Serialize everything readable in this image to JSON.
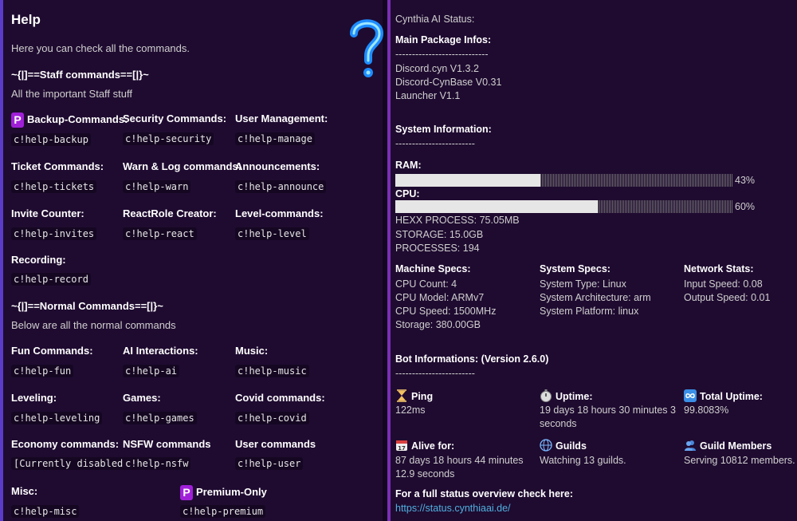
{
  "help": {
    "title": "Help",
    "intro": "Here you can check all the commands.",
    "staff_header": "~{|]==Staff commands==[|}~",
    "staff_desc": "All the important Staff stuff",
    "staff_commands": [
      {
        "label": "Backup-Commands:",
        "cmd": "c!help-backup",
        "premium": true
      },
      {
        "label": "Security Commands:",
        "cmd": "c!help-security"
      },
      {
        "label": "User Management:",
        "cmd": "c!help-manage"
      },
      {
        "label": "Ticket Commands:",
        "cmd": "c!help-tickets"
      },
      {
        "label": "Warn & Log commands:",
        "cmd": "c!help-warn"
      },
      {
        "label": "Announcements:",
        "cmd": "c!help-announce"
      },
      {
        "label": "Invite Counter:",
        "cmd": "c!help-invites"
      },
      {
        "label": "ReactRole Creator:",
        "cmd": "c!help-react"
      },
      {
        "label": "Level-commands:",
        "cmd": "c!help-level"
      },
      {
        "label": "Recording:",
        "cmd": "c!help-record"
      }
    ],
    "normal_header": "~{|]==Normal Commands==[|}~",
    "normal_desc": "Below are all the normal commands",
    "normal_commands": [
      {
        "label": "Fun Commands:",
        "cmd": "c!help-fun"
      },
      {
        "label": "AI Interactions:",
        "cmd": "c!help-ai"
      },
      {
        "label": "Music:",
        "cmd": "c!help-music"
      },
      {
        "label": "Leveling:",
        "cmd": "c!help-leveling"
      },
      {
        "label": "Games:",
        "cmd": "c!help-games"
      },
      {
        "label": "Covid commands:",
        "cmd": "c!help-covid"
      },
      {
        "label": "Economy commands:",
        "cmd": "[Currently disabled]"
      },
      {
        "label": "NSFW commands",
        "cmd": "c!help-nsfw"
      },
      {
        "label": "User commands",
        "cmd": "c!help-user"
      },
      {
        "label": "Misc:",
        "cmd": "c!help-misc"
      },
      {
        "label": "Premium-Only",
        "cmd": "c!help-premium",
        "premium": true
      }
    ],
    "premium_badge": "P"
  },
  "status": {
    "title": "Cynthia AI Status:",
    "pkg_header": "Main Package Infos:",
    "pkg_sep": "----------------------------",
    "packages": [
      "Discord.cyn V1.3.2",
      "Discord-CynBase V0.31",
      "Launcher V1.1"
    ],
    "sys_header": "System Information:",
    "sys_sep": "------------------------",
    "ram_label": "RAM:",
    "ram_pct": 43,
    "ram_text": "43%",
    "cpu_label": "CPU:",
    "cpu_pct": 60,
    "cpu_text": "60%",
    "hexx": "HEXX PROCESS: 75.05MB",
    "storage": "STORAGE: 15.0GB",
    "processes": "PROCESSES: 194",
    "machine_header": "Machine Specs:",
    "machine": [
      "CPU Count: 4",
      "CPU Model: ARMv7",
      "CPU Speed: 1500MHz",
      "Storage: 380.00GB"
    ],
    "sysspec_header": "System Specs:",
    "sysspec": [
      "System Type: Linux",
      "System Architecture: arm",
      "System Platform: linux"
    ],
    "net_header": "Network Stats:",
    "net": [
      "Input Speed: 0.08",
      "Output Speed: 0.01"
    ],
    "bot_header": "Bot Informations: (Version 2.6.0)",
    "bot_sep": "------------------------",
    "ping_label": "Ping",
    "ping_value": "122ms",
    "uptime_label": "Uptime:",
    "uptime_value_1": "19 days 18 hours 30 minutes 3",
    "uptime_value_2": "seconds",
    "total_label": "Total Uptime:",
    "total_value": "99.8083%",
    "alive_label": "Alive for:",
    "alive_value_1": "87 days 18 hours 44 minutes",
    "alive_value_2": "12.9 seconds",
    "guilds_label": "Guilds",
    "guilds_value": "Watching 13 guilds.",
    "members_label": "Guild Members",
    "members_value": "Serving 10812 members.",
    "overview_label": "For a full status overview check here:",
    "overview_link": "https://status.cynthiaai.de/"
  },
  "icons": {
    "help": "question-mark-icon",
    "ping": "hourglass-icon",
    "uptime": "stopwatch-icon",
    "total": "infinity-icon",
    "alive": "calendar-icon",
    "guilds": "globe-icon",
    "members": "people-icon"
  }
}
